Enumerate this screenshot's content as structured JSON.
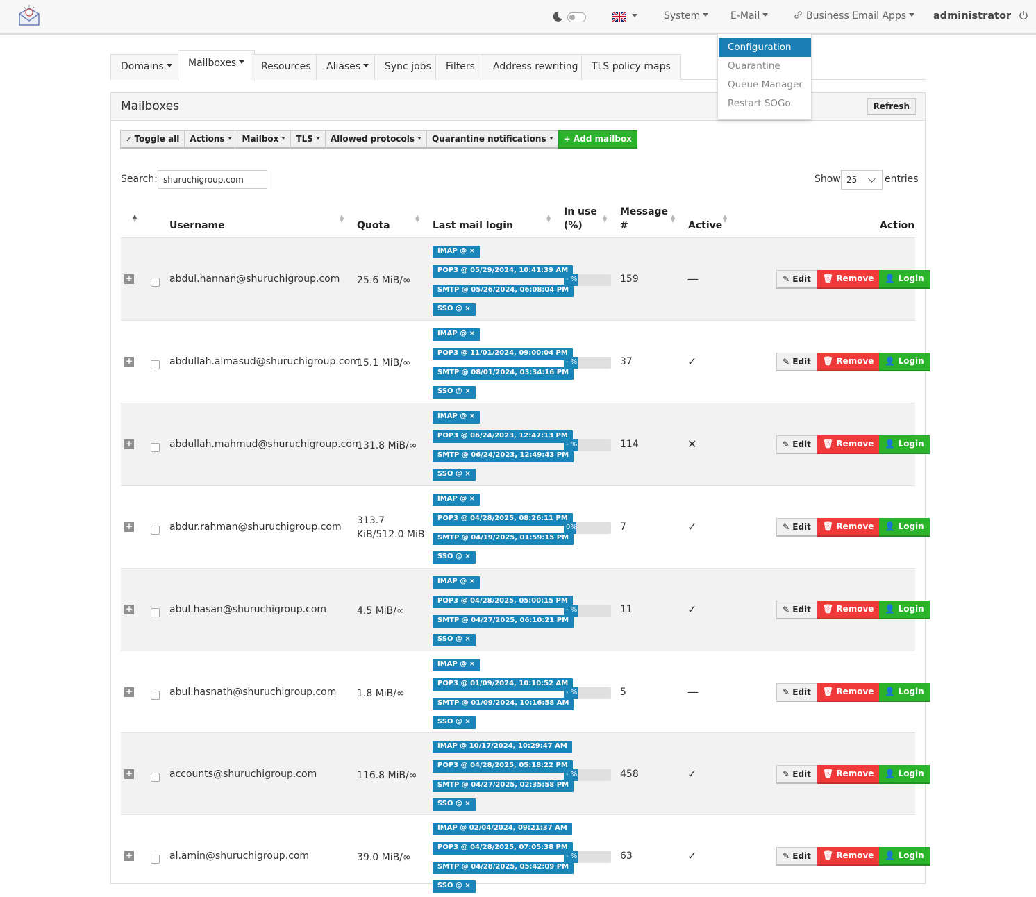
{
  "navbar": {
    "system": "System",
    "email": "E-Mail",
    "apps": "Business Email Apps",
    "user": "administrator"
  },
  "email_menu": [
    "Configuration",
    "Quarantine",
    "Queue Manager",
    "Restart SOGo"
  ],
  "tabs": [
    "Domains",
    "Mailboxes",
    "Resources",
    "Aliases",
    "Sync jobs",
    "Filters",
    "Address rewriting",
    "TLS policy maps"
  ],
  "panel": {
    "title": "Mailboxes",
    "refresh": "Refresh"
  },
  "toolbar": {
    "toggle_all": "Toggle all",
    "actions": "Actions",
    "mailbox": "Mailbox",
    "tls": "TLS",
    "protocols": "Allowed protocols",
    "quarantine": "Quarantine notifications",
    "add": "Add mailbox"
  },
  "search": {
    "label": "Search:",
    "value": "shuruchigroup.com"
  },
  "show": {
    "label": "Show",
    "value": "25",
    "suffix": "entries"
  },
  "columns": {
    "username": "Username",
    "quota": "Quota",
    "last_login": "Last mail login",
    "in_use_1": "In use",
    "in_use_2": "(%)",
    "msg_1": "Message",
    "msg_2": "#",
    "active": "Active",
    "action": "Action"
  },
  "buttons": {
    "edit": "Edit",
    "remove": "Remove",
    "login": "Login"
  },
  "rows": [
    {
      "username": "abdul.hannan@shuruchigroup.com",
      "quota": "25.6 MiB/∞",
      "logins": [
        "IMAP @ ×",
        "POP3 @ 05/29/2024, 10:41:39 AM",
        "SMTP @ 05/26/2024, 06:08:04 PM",
        "SSO @ ×"
      ],
      "in_use": "- %",
      "messages": "159",
      "active": "—"
    },
    {
      "username": "abdullah.almasud@shuruchigroup.com",
      "quota": "15.1 MiB/∞",
      "logins": [
        "IMAP @ ×",
        "POP3 @ 11/01/2024, 09:00:04 PM",
        "SMTP @ 08/01/2024, 03:34:16 PM",
        "SSO @ ×"
      ],
      "in_use": "- %",
      "messages": "37",
      "active": "✓"
    },
    {
      "username": "abdullah.mahmud@shuruchigroup.com",
      "quota": "131.8 MiB/∞",
      "logins": [
        "IMAP @ ×",
        "POP3 @ 06/24/2023, 12:47:13 PM",
        "SMTP @ 06/24/2023, 12:49:43 PM",
        "SSO @ ×"
      ],
      "in_use": "- %",
      "messages": "114",
      "active": "✕"
    },
    {
      "username": "abdur.rahman@shuruchigroup.com",
      "quota": "313.7 KiB/512.0 MiB",
      "logins": [
        "IMAP @ ×",
        "POP3 @ 04/28/2025, 08:26:11 PM",
        "SMTP @ 04/19/2025, 01:59:15 PM",
        "SSO @ ×"
      ],
      "in_use": "0%",
      "messages": "7",
      "active": "✓"
    },
    {
      "username": "abul.hasan@shuruchigroup.com",
      "quota": "4.5 MiB/∞",
      "logins": [
        "IMAP @ ×",
        "POP3 @ 04/28/2025, 05:00:15 PM",
        "SMTP @ 04/27/2025, 06:10:21 PM",
        "SSO @ ×"
      ],
      "in_use": "- %",
      "messages": "11",
      "active": "✓"
    },
    {
      "username": "abul.hasnath@shuruchigroup.com",
      "quota": "1.8 MiB/∞",
      "logins": [
        "IMAP @ ×",
        "POP3 @ 01/09/2024, 10:10:52 AM",
        "SMTP @ 01/09/2024, 10:16:58 AM",
        "SSO @ ×"
      ],
      "in_use": "- %",
      "messages": "5",
      "active": "—"
    },
    {
      "username": "accounts@shuruchigroup.com",
      "quota": "116.8 MiB/∞",
      "logins": [
        "IMAP @ 10/17/2024, 10:29:47 AM",
        "POP3 @ 04/28/2025, 05:18:22 PM",
        "SMTP @ 04/27/2025, 02:35:58 PM",
        "SSO @ ×"
      ],
      "in_use": "- %",
      "messages": "458",
      "active": "✓"
    },
    {
      "username": "al.amin@shuruchigroup.com",
      "quota": "39.0 MiB/∞",
      "logins": [
        "IMAP @ 02/04/2024, 09:21:37 AM",
        "POP3 @ 04/28/2025, 07:05:38 PM",
        "SMTP @ 04/28/2025, 05:42:09 PM",
        "SSO @ ×"
      ],
      "in_use": "- %",
      "messages": "63",
      "active": "✓"
    }
  ]
}
